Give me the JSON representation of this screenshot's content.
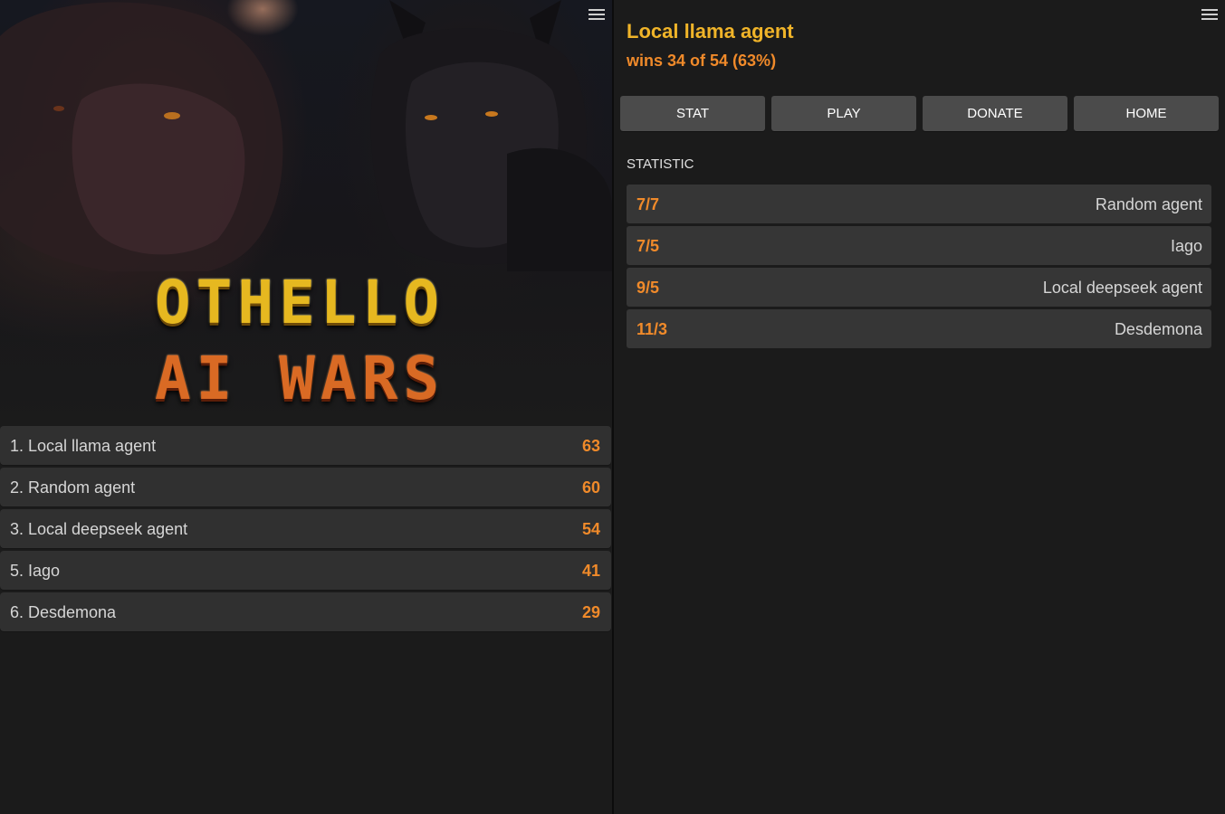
{
  "colors": {
    "background": "#1b1b1b",
    "row_background": "#303030",
    "button_background": "#4b4b4b",
    "accent_orange": "#f08a2a",
    "accent_yellow": "#f0b429"
  },
  "left": {
    "menu_icon": "hamburger-menu-icon",
    "logo": {
      "line1": "OTHELLO",
      "line2": "AI WARS"
    },
    "ranking": [
      {
        "label": "1. Local llama agent",
        "score": "63"
      },
      {
        "label": "2. Random agent",
        "score": "60"
      },
      {
        "label": "3. Local deepseek agent",
        "score": "54"
      },
      {
        "label": "5. Iago",
        "score": "41"
      },
      {
        "label": "6. Desdemona",
        "score": "29"
      }
    ]
  },
  "right": {
    "menu_icon": "hamburger-menu-icon",
    "agent_name": "Local llama agent",
    "wins_summary": "wins 34 of 54 (63%)",
    "nav": {
      "stat": "STAT",
      "play": "PLAY",
      "donate": "DONATE",
      "home": "HOME"
    },
    "section_title": "STATISTIC",
    "stats": [
      {
        "score": "7/7",
        "opponent": "Random agent"
      },
      {
        "score": "7/5",
        "opponent": "Iago"
      },
      {
        "score": "9/5",
        "opponent": "Local deepseek agent"
      },
      {
        "score": "11/3",
        "opponent": "Desdemona"
      }
    ]
  }
}
